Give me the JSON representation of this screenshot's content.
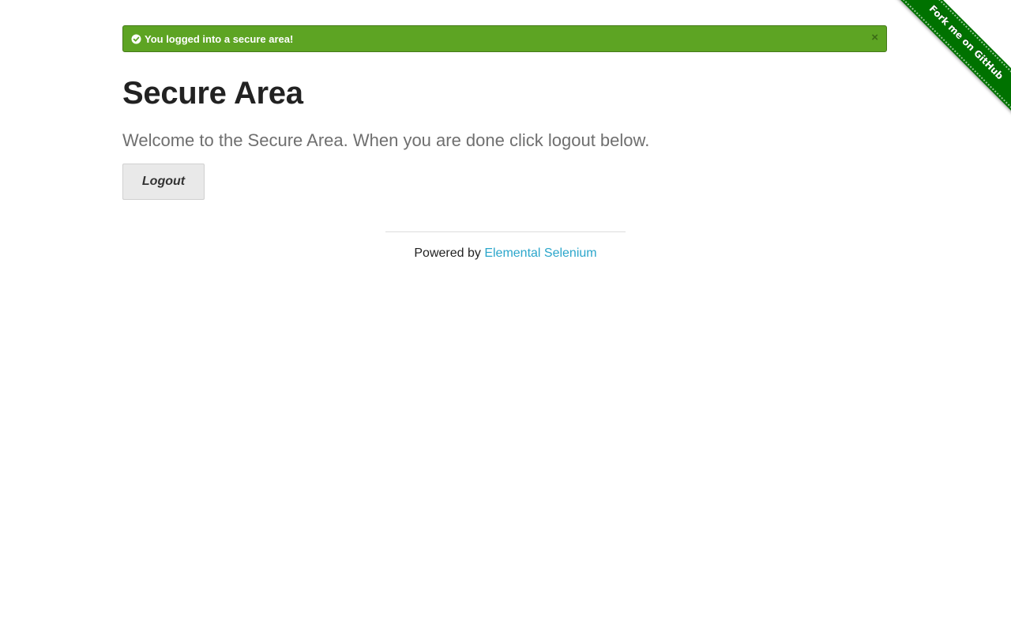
{
  "flash": {
    "message": "You logged into a secure area!",
    "close_glyph": "×",
    "icon": "check-circle-icon",
    "color": "#5da423"
  },
  "main": {
    "title": "Secure Area",
    "subheader": "Welcome to the Secure Area. When you are done click logout below.",
    "logout_label": "Logout"
  },
  "footer": {
    "prefix": "Powered by ",
    "link_text": "Elemental Selenium",
    "link_color": "#2ba6cb"
  },
  "ribbon": {
    "label": "Fork me on GitHub",
    "color": "#007200"
  }
}
